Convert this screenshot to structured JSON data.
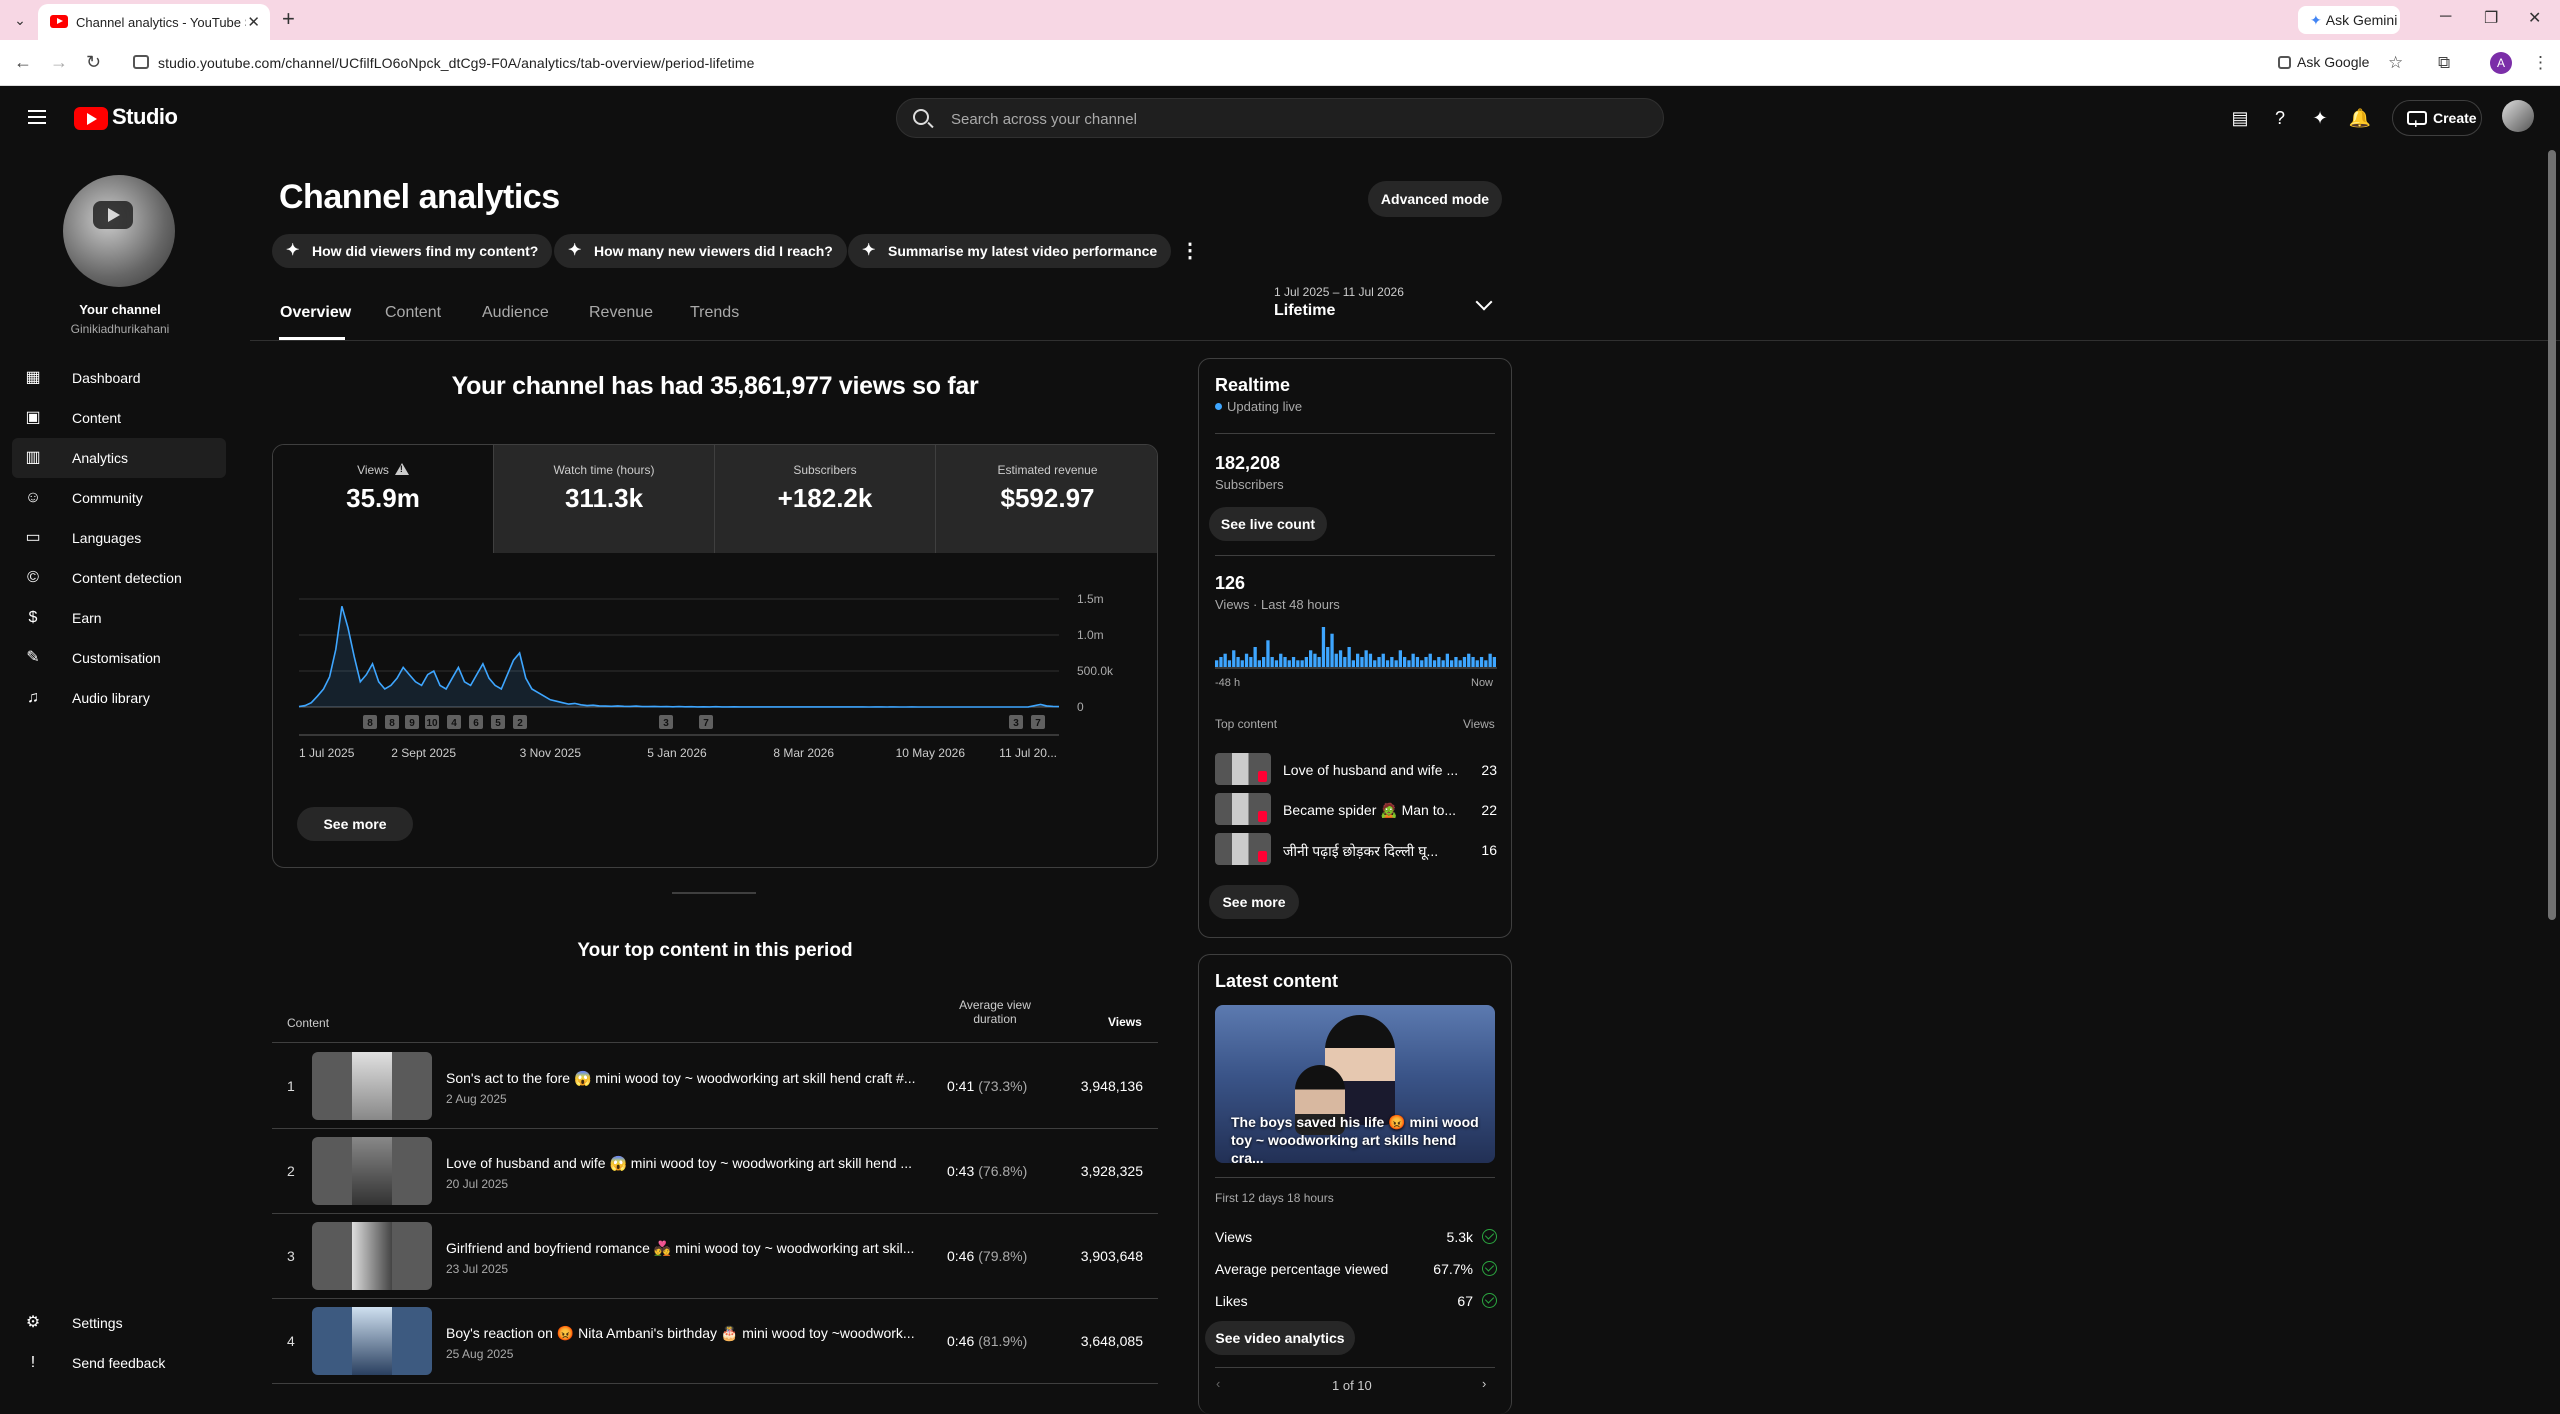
{
  "browser": {
    "tab_title": "Channel analytics - YouTube Studio",
    "tab_close": "✕",
    "new_tab": "+",
    "ask_gemini": "Ask Gemini",
    "url": "studio.youtube.com/channel/UCfilfLO6oNpck_dtCg9-F0A/analytics/tab-overview/period-lifetime",
    "ask_google": "Ask Google",
    "profile_initial": "A"
  },
  "header": {
    "logo_text": "Studio",
    "search_placeholder": "Search across your channel",
    "create_label": "Create"
  },
  "sidebar": {
    "channel_label": "Your channel",
    "channel_handle": "Ginikiadhurikahani",
    "items": [
      {
        "label": "Dashboard",
        "icon": "dashboard-icon"
      },
      {
        "label": "Content",
        "icon": "content-icon"
      },
      {
        "label": "Analytics",
        "icon": "analytics-icon"
      },
      {
        "label": "Community",
        "icon": "community-icon"
      },
      {
        "label": "Languages",
        "icon": "languages-icon"
      },
      {
        "label": "Content detection",
        "icon": "copyright-icon"
      },
      {
        "label": "Earn",
        "icon": "dollar-icon"
      },
      {
        "label": "Customisation",
        "icon": "magic-wand-icon"
      },
      {
        "label": "Audio library",
        "icon": "audio-library-icon"
      }
    ],
    "settings": "Settings",
    "feedback": "Send feedback"
  },
  "main": {
    "title": "Channel analytics",
    "advanced_mode": "Advanced mode",
    "chips": [
      "How did viewers find my content?",
      "How many new viewers did I reach?",
      "Summarise my latest video performance"
    ],
    "tabs": [
      "Overview",
      "Content",
      "Audience",
      "Revenue",
      "Trends"
    ],
    "period_range": "1 Jul 2025 – 11 Jul 2026",
    "period_name": "Lifetime",
    "views_headline": "Your channel has had 35,861,977 views so far",
    "metrics": [
      {
        "label": "Views",
        "value": "35.9m"
      },
      {
        "label": "Watch time (hours)",
        "value": "311.3k"
      },
      {
        "label": "Subscribers",
        "value": "+182.2k"
      },
      {
        "label": "Estimated revenue",
        "value": "$592.97"
      }
    ],
    "see_more": "See more",
    "top_content_heading": "Your top content in this period",
    "table_headers": {
      "content": "Content",
      "avd_line1": "Average view",
      "avd_line2": "duration",
      "views": "Views"
    },
    "top_content": [
      {
        "rank": "1",
        "title": "Son's act to the fore 😱 mini wood toy ~ woodworking art skill hend craft #...",
        "date": "2 Aug 2025",
        "avd": "0:41",
        "pct": "(73.3%)",
        "views": "3,948,136"
      },
      {
        "rank": "2",
        "title": "Love of husband and wife 😱 mini wood toy ~ woodworking art skill hend ...",
        "date": "20 Jul 2025",
        "avd": "0:43",
        "pct": "(76.8%)",
        "views": "3,928,325"
      },
      {
        "rank": "3",
        "title": "Girlfriend and boyfriend romance 💑 mini wood toy ~ woodworking art skil...",
        "date": "23 Jul 2025",
        "avd": "0:46",
        "pct": "(79.8%)",
        "views": "3,903,648"
      },
      {
        "rank": "4",
        "title": "Boy's reaction on 😡 Nita Ambani's birthday 🎂 mini wood toy ~woodwork...",
        "date": "25 Aug 2025",
        "avd": "0:46",
        "pct": "(81.9%)",
        "views": "3,648,085"
      }
    ]
  },
  "realtime": {
    "title": "Realtime",
    "status": "Updating live",
    "subscribers": "182,208",
    "subscribers_label": "Subscribers",
    "see_live_count": "See live count",
    "views": "126",
    "views_label": "Views · Last 48 hours",
    "axis_start": "-48 h",
    "axis_end": "Now",
    "top_content_label": "Top content",
    "views_col": "Views",
    "top_content": [
      {
        "title": "Love of husband and wife ...",
        "views": "23"
      },
      {
        "title": "Became spider 🧟 Man to...",
        "views": "22"
      },
      {
        "title": "जीनी पढ़ाई छोड़कर दिल्ली घू...",
        "views": "16"
      }
    ],
    "see_more": "See more",
    "hourly_views": [
      2,
      3,
      4,
      2,
      5,
      3,
      2,
      4,
      3,
      6,
      2,
      3,
      8,
      3,
      2,
      4,
      3,
      2,
      3,
      2,
      2,
      3,
      5,
      4,
      3,
      12,
      6,
      10,
      4,
      5,
      3,
      6,
      2,
      4,
      3,
      5,
      4,
      2,
      3,
      4,
      2,
      3,
      2,
      5,
      3,
      2,
      4,
      3,
      2,
      3,
      4,
      2,
      3,
      2,
      4,
      2,
      3,
      2,
      3,
      4,
      3,
      2,
      3,
      2,
      4,
      3
    ]
  },
  "latest": {
    "title": "Latest content",
    "video_title": "The boys saved his life 😡 mini wood toy ~ woodworking art skills hend cra...",
    "period": "First 12 days 18 hours",
    "stats": [
      {
        "label": "Views",
        "value": "5.3k"
      },
      {
        "label": "Average percentage viewed",
        "value": "67.7%"
      },
      {
        "label": "Likes",
        "value": "67"
      }
    ],
    "see_video_analytics": "See video analytics",
    "pager": "1 of 10"
  },
  "chart_data": {
    "type": "line",
    "title": "",
    "metric": "Views",
    "x_tick_labels": [
      "1 Jul 2025",
      "2 Sept 2025",
      "3 Nov 2025",
      "5 Jan 2026",
      "8 Mar 2026",
      "10 May 2026",
      "11 Jul 20..."
    ],
    "y_tick_labels": [
      "0",
      "500.0k",
      "1.0m",
      "1.5m"
    ],
    "ylim": [
      0,
      1500000
    ],
    "x_days": 376,
    "series": [
      {
        "values": [
          5000,
          20000,
          60000,
          150000,
          250000,
          420000,
          800000,
          1400000,
          1100000,
          700000,
          350000,
          450000,
          600000,
          350000,
          250000,
          300000,
          400000,
          550000,
          450000,
          350000,
          300000,
          450000,
          500000,
          300000,
          250000,
          400000,
          550000,
          350000,
          300000,
          450000,
          600000,
          400000,
          300000,
          250000,
          450000,
          650000,
          750000,
          400000,
          250000,
          200000,
          150000,
          100000,
          80000,
          60000,
          40000,
          50000,
          30000,
          20000,
          25000,
          15000,
          12000,
          10000,
          15000,
          10000,
          8000,
          12000,
          6000,
          5000,
          8000,
          4000,
          5000,
          3000,
          5000,
          3000,
          4000,
          2000,
          3000,
          2000,
          4000,
          2000,
          2000,
          3000,
          2000,
          1500,
          2000,
          1500,
          2000,
          1500,
          1000,
          2000,
          1500,
          1000,
          1500,
          1000,
          2000,
          1000,
          1500,
          1000,
          800,
          1200,
          800,
          1000,
          800,
          600,
          1000,
          700,
          600,
          800,
          600,
          500,
          700,
          500,
          600,
          500,
          400,
          600,
          500,
          400,
          500,
          400,
          600,
          500,
          400,
          500,
          400,
          500,
          600,
          500,
          400,
          800,
          20000,
          35000,
          15000,
          8000,
          5000
        ]
      }
    ],
    "annotation_markers": [
      "8",
      "8",
      "9",
      "10",
      "4",
      "6",
      "5",
      "2",
      "3",
      "7",
      "3",
      "7"
    ]
  }
}
